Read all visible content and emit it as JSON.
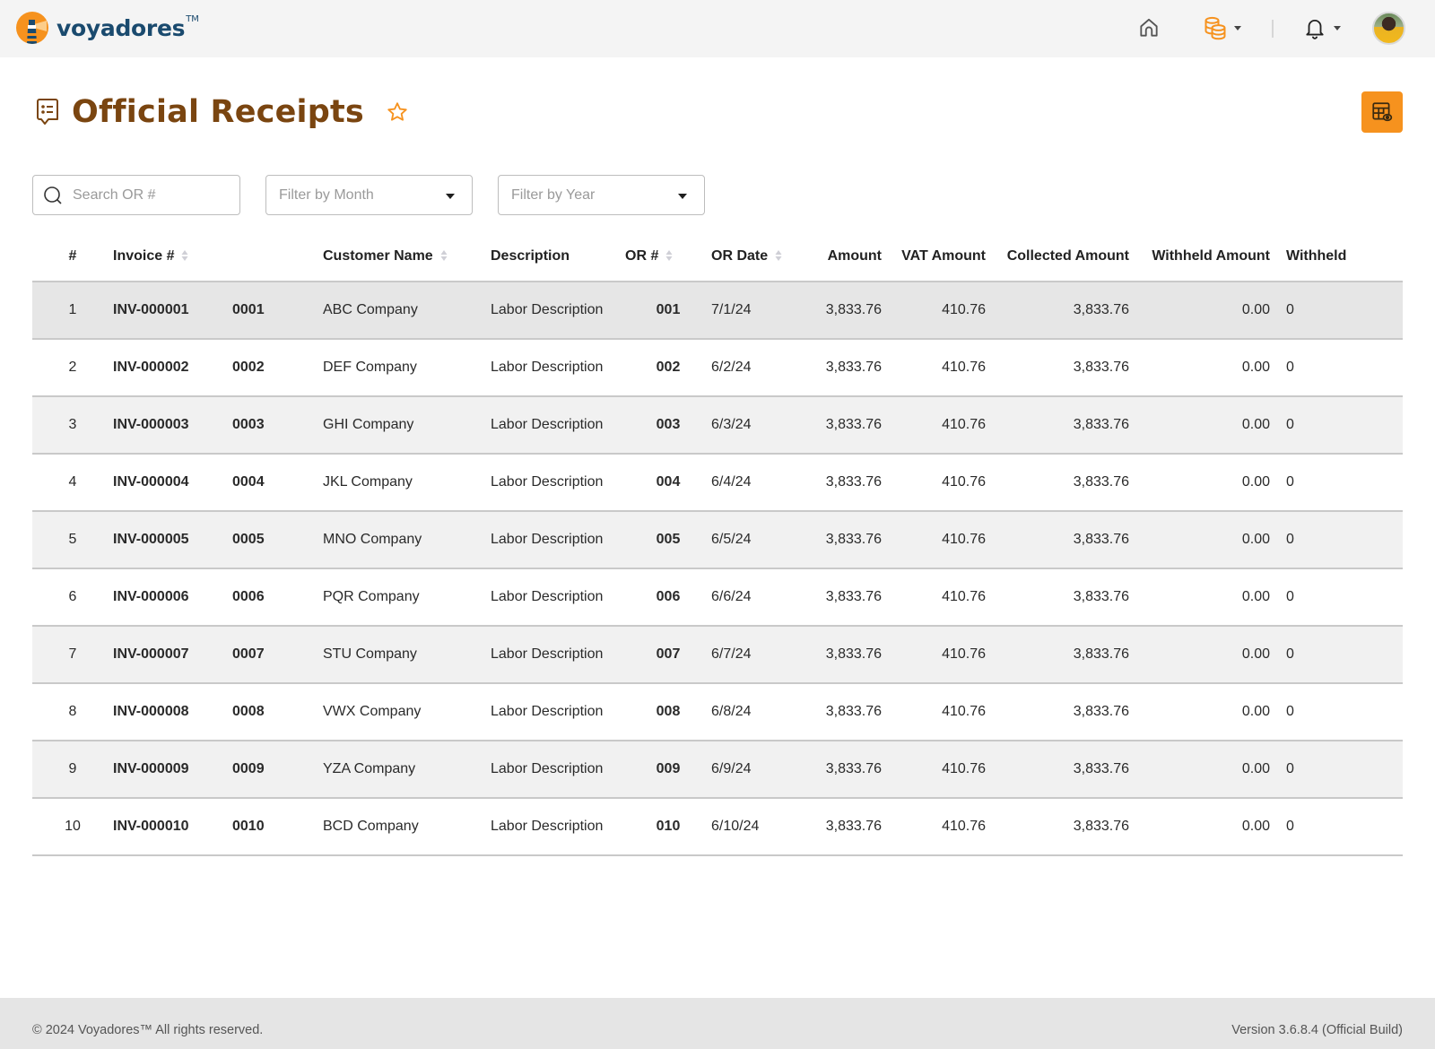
{
  "navbar": {
    "brand_name": "voyadores",
    "brand_tm": "TM",
    "icons": [
      "home-icon",
      "coins-icon",
      "bell-icon",
      "user-avatar"
    ],
    "accent_color": "#f6921e"
  },
  "header": {
    "title": "Official Receipts",
    "title_color": "#7a4510",
    "favorite": false
  },
  "filters": {
    "search_placeholder": "Search OR #",
    "search_value": "",
    "month_placeholder": "Filter by Month",
    "year_placeholder": "Filter by Year"
  },
  "table": {
    "columns": [
      {
        "label": "#",
        "sortable": false
      },
      {
        "label": "Invoice #",
        "sortable": true
      },
      {
        "label": "",
        "sortable": false
      },
      {
        "label": "Customer Name",
        "sortable": true
      },
      {
        "label": "Description",
        "sortable": false
      },
      {
        "label": "OR #",
        "sortable": true
      },
      {
        "label": "OR Date",
        "sortable": true
      },
      {
        "label": "Amount",
        "sortable": false
      },
      {
        "label": "VAT Amount",
        "sortable": false
      },
      {
        "label": "Collected Amount",
        "sortable": false
      },
      {
        "label": "Withheld Amount",
        "sortable": false
      },
      {
        "label": "Withheld",
        "sortable": false
      }
    ],
    "rows": [
      {
        "idx": "1",
        "invoice": "INV-000001",
        "code": "0001",
        "customer": "ABC Company",
        "description": "Labor Description",
        "or_no": "001",
        "or_date": "7/1/24",
        "amount": "3,833.76",
        "vat": "410.76",
        "collected": "3,833.76",
        "withheld_amount": "0.00",
        "withheld": "0"
      },
      {
        "idx": "2",
        "invoice": "INV-000002",
        "code": "0002",
        "customer": "DEF Company",
        "description": "Labor Description",
        "or_no": "002",
        "or_date": "6/2/24",
        "amount": "3,833.76",
        "vat": "410.76",
        "collected": "3,833.76",
        "withheld_amount": "0.00",
        "withheld": "0"
      },
      {
        "idx": "3",
        "invoice": "INV-000003",
        "code": "0003",
        "customer": "GHI Company",
        "description": "Labor Description",
        "or_no": "003",
        "or_date": "6/3/24",
        "amount": "3,833.76",
        "vat": "410.76",
        "collected": "3,833.76",
        "withheld_amount": "0.00",
        "withheld": "0"
      },
      {
        "idx": "4",
        "invoice": "INV-000004",
        "code": "0004",
        "customer": "JKL Company",
        "description": "Labor Description",
        "or_no": "004",
        "or_date": "6/4/24",
        "amount": "3,833.76",
        "vat": "410.76",
        "collected": "3,833.76",
        "withheld_amount": "0.00",
        "withheld": "0"
      },
      {
        "idx": "5",
        "invoice": "INV-000005",
        "code": "0005",
        "customer": "MNO Company",
        "description": "Labor Description",
        "or_no": "005",
        "or_date": "6/5/24",
        "amount": "3,833.76",
        "vat": "410.76",
        "collected": "3,833.76",
        "withheld_amount": "0.00",
        "withheld": "0"
      },
      {
        "idx": "6",
        "invoice": "INV-000006",
        "code": "0006",
        "customer": "PQR Company",
        "description": "Labor Description",
        "or_no": "006",
        "or_date": "6/6/24",
        "amount": "3,833.76",
        "vat": "410.76",
        "collected": "3,833.76",
        "withheld_amount": "0.00",
        "withheld": "0"
      },
      {
        "idx": "7",
        "invoice": "INV-000007",
        "code": "0007",
        "customer": "STU Company",
        "description": "Labor Description",
        "or_no": "007",
        "or_date": "6/7/24",
        "amount": "3,833.76",
        "vat": "410.76",
        "collected": "3,833.76",
        "withheld_amount": "0.00",
        "withheld": "0"
      },
      {
        "idx": "8",
        "invoice": "INV-000008",
        "code": "0008",
        "customer": "VWX Company",
        "description": "Labor Description",
        "or_no": "008",
        "or_date": "6/8/24",
        "amount": "3,833.76",
        "vat": "410.76",
        "collected": "3,833.76",
        "withheld_amount": "0.00",
        "withheld": "0"
      },
      {
        "idx": "9",
        "invoice": "INV-000009",
        "code": "0009",
        "customer": "YZA Company",
        "description": "Labor Description",
        "or_no": "009",
        "or_date": "6/9/24",
        "amount": "3,833.76",
        "vat": "410.76",
        "collected": "3,833.76",
        "withheld_amount": "0.00",
        "withheld": "0"
      },
      {
        "idx": "10",
        "invoice": "INV-000010",
        "code": "0010",
        "customer": "BCD Company",
        "description": "Labor Description",
        "or_no": "010",
        "or_date": "6/10/24",
        "amount": "3,833.76",
        "vat": "410.76",
        "collected": "3,833.76",
        "withheld_amount": "0.00",
        "withheld": "0"
      }
    ]
  },
  "footer": {
    "copyright": "© 2024 Voyadores™ All rights reserved.",
    "version": "Version 3.6.8.4 (Official Build)"
  }
}
